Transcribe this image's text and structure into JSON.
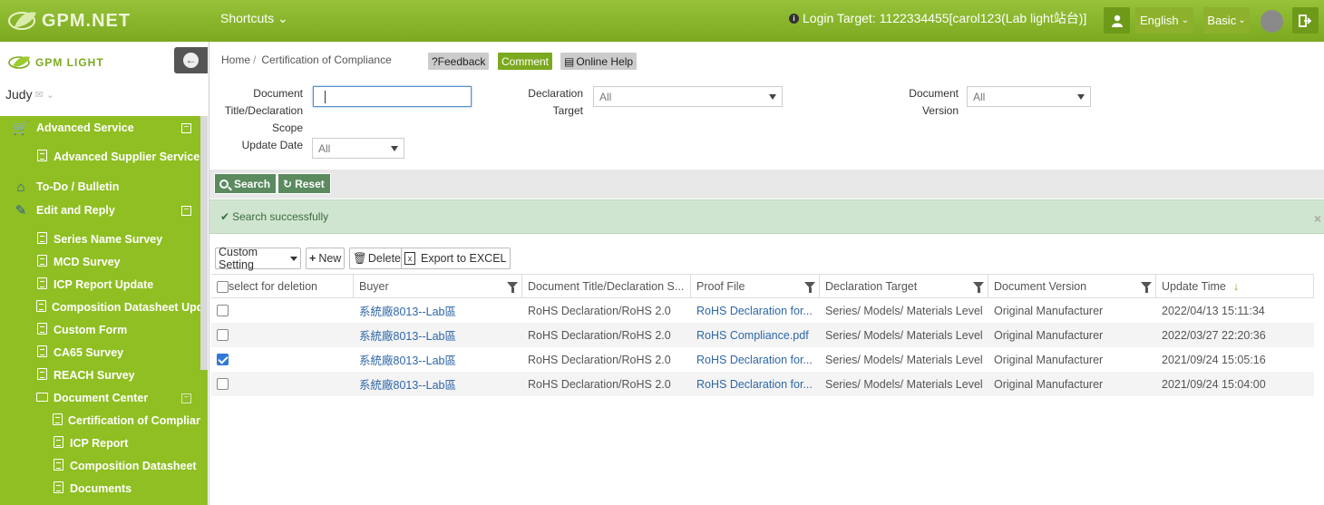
{
  "topbar": {
    "brand": "GPM.NET",
    "shortcuts": "Shortcuts",
    "login_label": "Login Target:",
    "login_target": "1122334455[carol123(Lab light站台)]",
    "language": "English",
    "level": "Basic"
  },
  "sidebar": {
    "logo_text": "GPM LIGHT",
    "user": "Judy",
    "menu": {
      "advanced_service": "Advanced Service",
      "advanced_supplier_service": "Advanced Supplier Service",
      "todo_bulletin": "To-Do / Bulletin",
      "edit_and_reply": "Edit and Reply",
      "series_name_survey": "Series Name Survey",
      "mcd_survey": "MCD Survey",
      "icp_report_update": "ICP Report Update",
      "composition_datasheet_update": "Composition Datasheet Update",
      "custom_form": "Custom Form",
      "ca65_survey": "CA65 Survey",
      "reach_survey": "REACH Survey",
      "document_center": "Document Center",
      "certification_of_compliance": "Certification of Compliance",
      "icp_report": "ICP Report",
      "composition_datasheet": "Composition Datasheet",
      "documents": "Documents"
    }
  },
  "breadcrumb": {
    "home": "Home",
    "separator": "/",
    "current": "Certification of Compliance"
  },
  "actions": {
    "feedback": "?Feedback",
    "comment": "Comment",
    "online_help": "Online Help"
  },
  "filters": {
    "doc_title_label": "Document Title/Declaration Scope",
    "doc_title_value": "",
    "declaration_target_label": "Declaration Target",
    "declaration_target_value": "All",
    "document_version_label": "Document Version",
    "document_version_value": "All",
    "update_date_label": "Update Date",
    "update_date_value": "All"
  },
  "search": {
    "search_label": "Search",
    "reset_label": "Reset"
  },
  "alert": {
    "message": "Search successfully",
    "close": "×"
  },
  "toolbar": {
    "custom_setting": "Custom Setting",
    "new": "New",
    "delete": "Delete",
    "export": "Export to EXCEL"
  },
  "grid": {
    "columns": [
      "select for deletion",
      "Buyer",
      "Document Title/Declaration S...",
      "Proof File",
      "Declaration Target",
      "Document Version",
      "Update Time"
    ],
    "rows": [
      {
        "checked": false,
        "buyer": "系統廠8013--Lab區",
        "title": "RoHS Declaration/RoHS 2.0",
        "proof": "RoHS Declaration for...",
        "target": "Series/ Models/ Materials Level",
        "version": "Original Manufacturer",
        "time": "2022/04/13 15:11:34"
      },
      {
        "checked": false,
        "buyer": "系統廠8013--Lab區",
        "title": "RoHS Declaration/RoHS 2.0",
        "proof": "RoHS Compliance.pdf",
        "target": "Series/ Models/ Materials Level",
        "version": "Original Manufacturer",
        "time": "2022/03/27 22:20:36"
      },
      {
        "checked": true,
        "buyer": "系統廠8013--Lab區",
        "title": "RoHS Declaration/RoHS 2.0",
        "proof": "RoHS Declaration for...",
        "target": "Series/ Models/ Materials Level",
        "version": "Original Manufacturer",
        "time": "2021/09/24 15:05:16"
      },
      {
        "checked": false,
        "buyer": "系統廠8013--Lab區",
        "title": "RoHS Declaration/RoHS 2.0",
        "proof": "RoHS Declaration for...",
        "target": "Series/ Models/ Materials Level",
        "version": "Original Manufacturer",
        "time": "2021/09/24 15:04:00"
      }
    ]
  },
  "colors": {
    "brand_green": "#8fbf22",
    "link_blue": "#2e67a8",
    "search_green": "#5a8a5e"
  }
}
